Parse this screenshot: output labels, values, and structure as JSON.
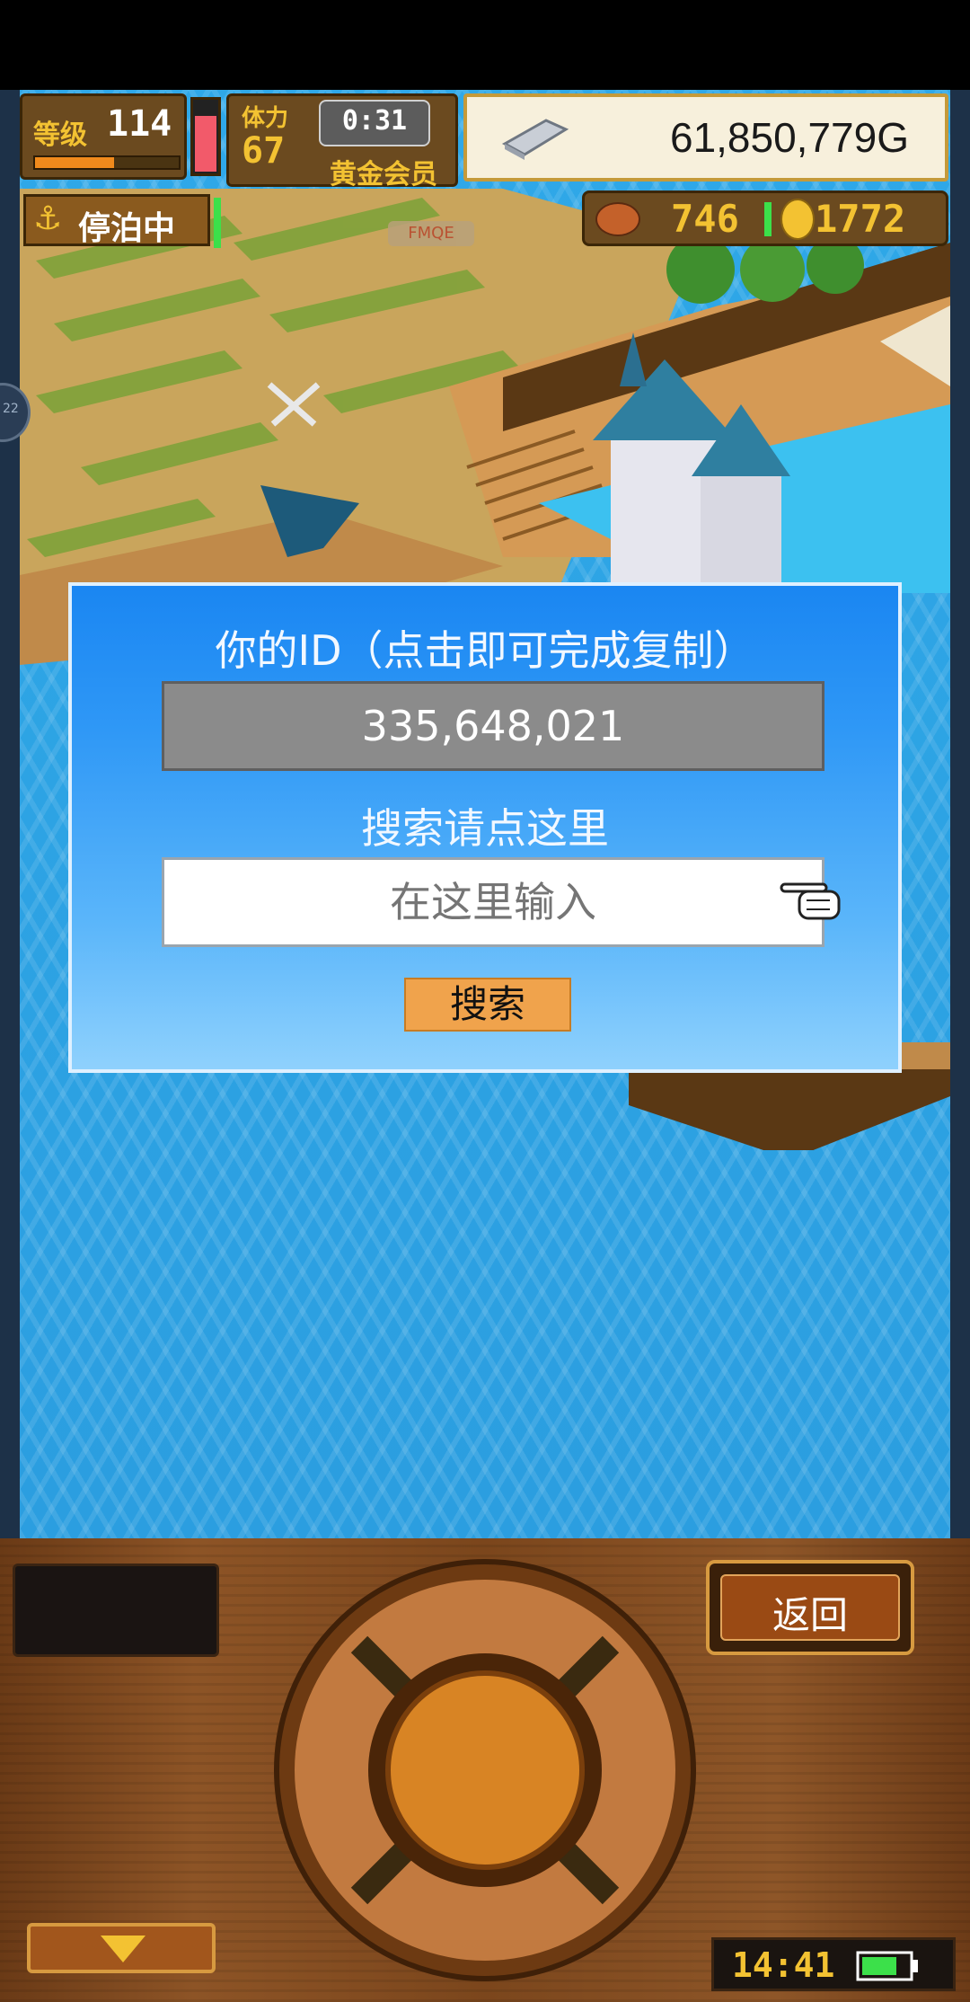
{
  "hud": {
    "level_label": "等级",
    "level_value": "114",
    "stamina_label": "体力",
    "stamina_value": "67",
    "timer": "0:31",
    "membership": "黄金会员",
    "money": "61,850,779G",
    "status": "停泊中",
    "food_count": "746",
    "medal_count": "1772"
  },
  "map": {
    "area_sign": "FMQE"
  },
  "dialog": {
    "id_title": "你的ID（点击即可完成复制）",
    "id_value": "335,648,021",
    "search_prompt": "搜索请点这里",
    "input_placeholder": "在这里输入",
    "search_button": "搜索"
  },
  "controls": {
    "back_button": "返回",
    "clock": "14:41"
  },
  "side_bubble": "22",
  "colors": {
    "dialog_top": "#1a86f2",
    "dialog_bottom": "#8fd1fd",
    "search_button": "#f0a34c",
    "wood": "#7b461c",
    "water": "#2fa8e8"
  },
  "icons": [
    "anchor-icon",
    "silver-bar-icon",
    "food-icon",
    "medal-icon",
    "pointing-hand-icon",
    "dpad",
    "battery-icon",
    "down-arrow-icon",
    "swords-icon"
  ]
}
